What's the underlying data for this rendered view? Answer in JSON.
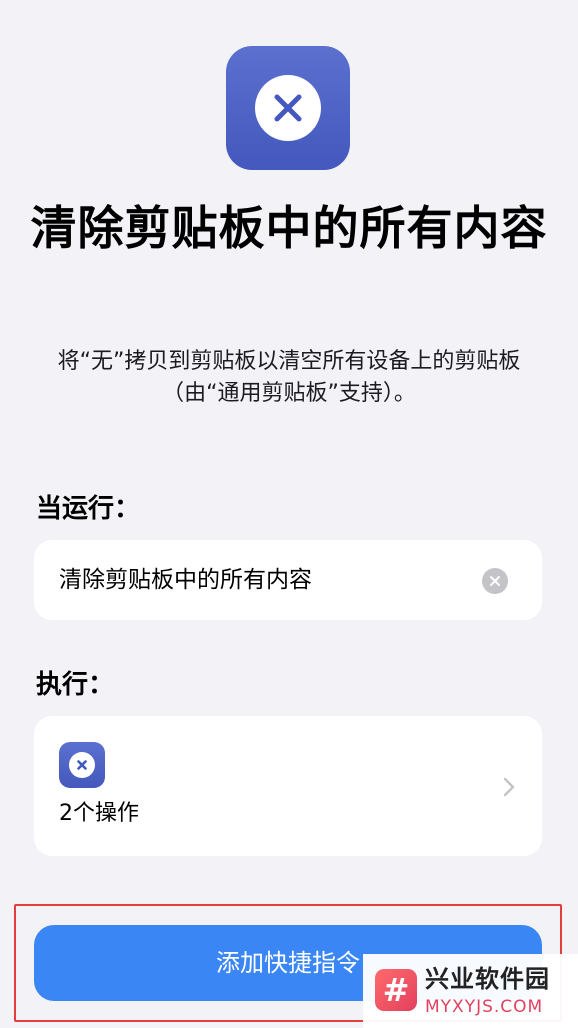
{
  "header": {
    "icon": "clear-clipboard-icon",
    "icon_color": "#4a5ec6",
    "title": "清除剪贴板中的所有内容",
    "description": "将“无”拷贝到剪贴板以清空所有设备上的剪贴板（由“通用剪贴板”支持）。"
  },
  "when_run": {
    "label": "当运行：",
    "value": "清除剪贴板中的所有内容",
    "clear_icon": "clear-circle-icon"
  },
  "execute": {
    "label": "执行：",
    "action_count": "2个操作",
    "icon": "clear-clipboard-icon",
    "chevron": "chevron-right-icon"
  },
  "primary_button": {
    "label": "添加快捷指令",
    "color": "#3a86f5"
  },
  "watermark": {
    "logo_glyph": "#",
    "name": "兴业软件园",
    "url": "MYXYJS.COM"
  }
}
